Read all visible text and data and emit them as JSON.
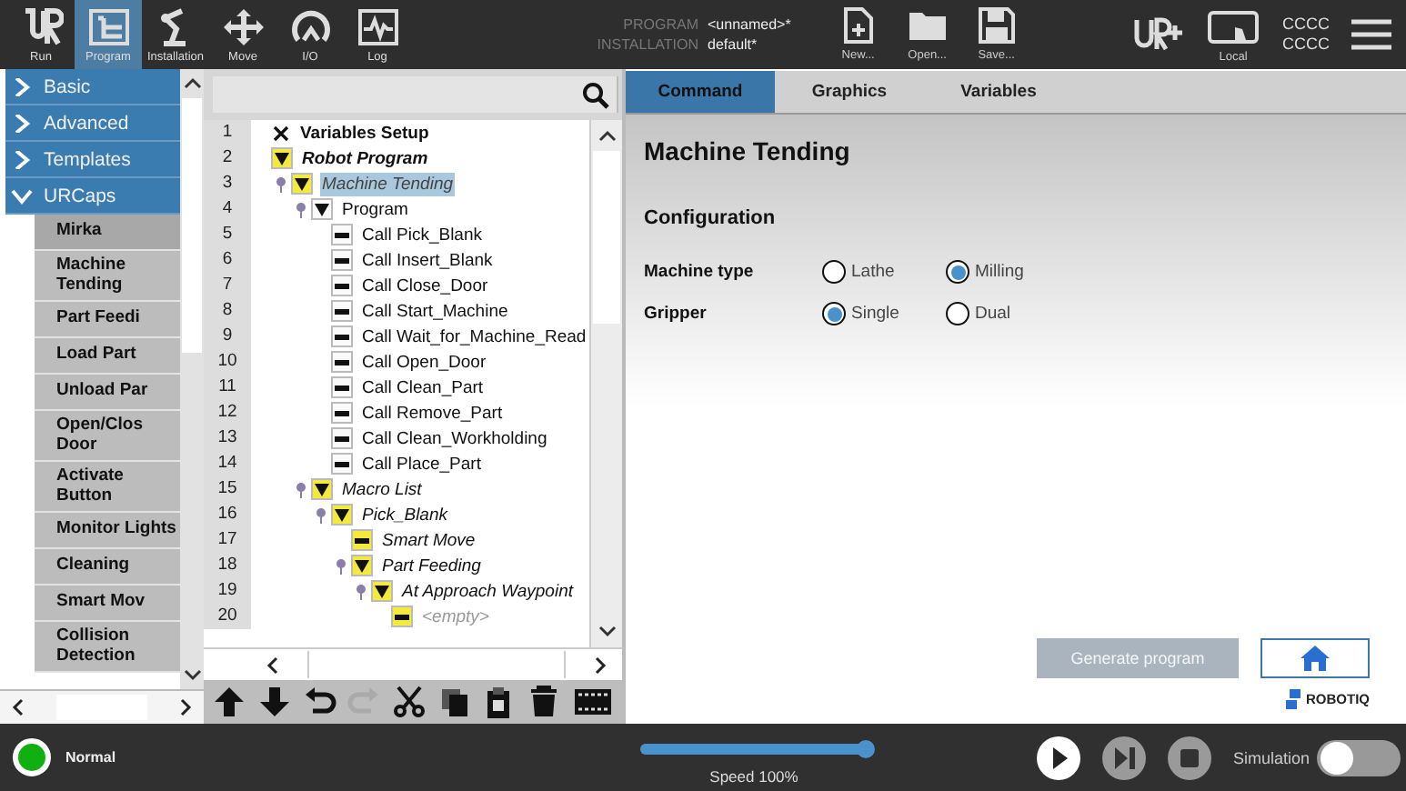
{
  "top_bar": {
    "nav": [
      {
        "label": "Run",
        "selected": false
      },
      {
        "label": "Program",
        "selected": true
      },
      {
        "label": "Installation",
        "selected": false
      },
      {
        "label": "Move",
        "selected": false
      },
      {
        "label": "I/O",
        "selected": false
      },
      {
        "label": "Log",
        "selected": false
      }
    ],
    "program_label": "PROGRAM",
    "program_value": "<unnamed>*",
    "installation_label": "INSTALLATION",
    "installation_value": "default*",
    "file_buttons": [
      {
        "label": "New..."
      },
      {
        "label": "Open..."
      },
      {
        "label": "Save..."
      }
    ],
    "local_label": "Local",
    "id_lines": [
      "CCCC",
      "CCCC"
    ]
  },
  "categories": [
    {
      "label": "Basic",
      "expanded": false
    },
    {
      "label": "Advanced",
      "expanded": false
    },
    {
      "label": "Templates",
      "expanded": false
    },
    {
      "label": "URCaps",
      "expanded": true,
      "items": [
        {
          "label": "Mirka",
          "selected": true
        },
        {
          "label": "Machine Tending",
          "selected": false
        },
        {
          "label": "Part Feedi",
          "selected": false
        },
        {
          "label": "Load Part",
          "selected": false
        },
        {
          "label": "Unload Par",
          "selected": false
        },
        {
          "label": "Open/Clos Door",
          "selected": false
        },
        {
          "label": "Activate Button",
          "selected": false
        },
        {
          "label": "Monitor Lights",
          "selected": false
        },
        {
          "label": "Cleaning",
          "selected": false
        },
        {
          "label": "Smart Mov",
          "selected": false
        },
        {
          "label": "Collision Detection",
          "selected": false
        }
      ]
    }
  ],
  "tree": [
    {
      "line": "1",
      "label": "Variables Setup",
      "kind": "variables",
      "bold": true,
      "italic": false,
      "selected": false
    },
    {
      "line": "2",
      "label": "Robot Program",
      "kind": "folder",
      "highlighted": true,
      "bold": true,
      "italic": true,
      "selected": false,
      "children": [
        {
          "line": "3",
          "label": "Machine Tending",
          "kind": "folder",
          "highlighted": true,
          "bold": false,
          "italic": true,
          "selected": true,
          "children": [
            {
              "line": "4",
              "label": "Program",
              "kind": "folder",
              "highlighted": false,
              "bold": false,
              "italic": false,
              "selected": false,
              "children": [
                {
                  "line": "5",
                  "label": "Call Pick_Blank",
                  "kind": "command",
                  "highlighted": false,
                  "bold": false,
                  "italic": false,
                  "selected": false
                },
                {
                  "line": "6",
                  "label": "Call Insert_Blank",
                  "kind": "command",
                  "highlighted": false,
                  "bold": false,
                  "italic": false,
                  "selected": false
                },
                {
                  "line": "7",
                  "label": "Call Close_Door",
                  "kind": "command",
                  "highlighted": false,
                  "bold": false,
                  "italic": false,
                  "selected": false
                },
                {
                  "line": "8",
                  "label": "Call Start_Machine",
                  "kind": "command",
                  "highlighted": false,
                  "bold": false,
                  "italic": false,
                  "selected": false
                },
                {
                  "line": "9",
                  "label": "Call Wait_for_Machine_Read",
                  "kind": "command",
                  "highlighted": false,
                  "bold": false,
                  "italic": false,
                  "selected": false
                },
                {
                  "line": "10",
                  "label": "Call Open_Door",
                  "kind": "command",
                  "highlighted": false,
                  "bold": false,
                  "italic": false,
                  "selected": false
                },
                {
                  "line": "11",
                  "label": "Call Clean_Part",
                  "kind": "command",
                  "highlighted": false,
                  "bold": false,
                  "italic": false,
                  "selected": false
                },
                {
                  "line": "12",
                  "label": "Call Remove_Part",
                  "kind": "command",
                  "highlighted": false,
                  "bold": false,
                  "italic": false,
                  "selected": false
                },
                {
                  "line": "13",
                  "label": "Call Clean_Workholding",
                  "kind": "command",
                  "highlighted": false,
                  "bold": false,
                  "italic": false,
                  "selected": false
                },
                {
                  "line": "14",
                  "label": "Call Place_Part",
                  "kind": "command",
                  "highlighted": false,
                  "bold": false,
                  "italic": false,
                  "selected": false
                }
              ]
            },
            {
              "line": "15",
              "label": "Macro List",
              "kind": "folder",
              "highlighted": true,
              "bold": false,
              "italic": true,
              "selected": false,
              "children": [
                {
                  "line": "16",
                  "label": "Pick_Blank",
                  "kind": "folder",
                  "highlighted": true,
                  "bold": false,
                  "italic": true,
                  "selected": false,
                  "children": [
                    {
                      "line": "17",
                      "label": "Smart Move",
                      "kind": "command",
                      "highlighted": true,
                      "bold": false,
                      "italic": true,
                      "selected": false
                    },
                    {
                      "line": "18",
                      "label": "Part Feeding",
                      "kind": "folder",
                      "highlighted": true,
                      "bold": false,
                      "italic": true,
                      "selected": false,
                      "children": [
                        {
                          "line": "19",
                          "label": "At Approach Waypoint",
                          "kind": "folder",
                          "highlighted": true,
                          "bold": false,
                          "italic": true,
                          "selected": false,
                          "children": [
                            {
                              "line": "20",
                              "label": "<empty>",
                              "kind": "placeholder",
                              "highlighted": true,
                              "bold": false,
                              "italic": true,
                              "selected": false
                            }
                          ]
                        }
                      ]
                    }
                  ]
                }
              ]
            }
          ]
        }
      ]
    }
  ],
  "tabs": [
    {
      "label": "Command",
      "selected": true
    },
    {
      "label": "Graphics",
      "selected": false
    },
    {
      "label": "Variables",
      "selected": false
    }
  ],
  "command": {
    "title": "Machine Tending",
    "section": "Configuration",
    "fields": [
      {
        "label": "Machine type",
        "options": [
          {
            "label": "Lathe",
            "selected": false
          },
          {
            "label": "Milling",
            "selected": true
          }
        ]
      },
      {
        "label": "Gripper",
        "options": [
          {
            "label": "Single",
            "selected": true
          },
          {
            "label": "Dual",
            "selected": false
          }
        ]
      }
    ],
    "generate_button": {
      "label": "Generate program",
      "disabled": true
    },
    "brand": "ROBOTIQ"
  },
  "status": {
    "label": "Normal",
    "kind": "normal"
  },
  "speed": {
    "label": "Speed 100%",
    "level": 1
  },
  "simulation": {
    "label": "Simulation",
    "on": false
  }
}
